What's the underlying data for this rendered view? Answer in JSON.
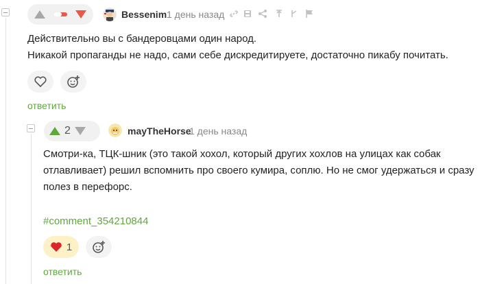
{
  "comment1": {
    "author": "Bessenim",
    "time": "1 день назад",
    "text_line1": "Действительно вы с бандеровцами один народ.",
    "text_line2": "Никакой пропаганды не надо, сами себе дискредитируете, достаточно пикабу почитать.",
    "reply_label": "ответить",
    "vote": {
      "down_active": true,
      "rating_bar_fraction": 0.45
    },
    "tool_icons": [
      "link-icon",
      "save-icon",
      "share-icon",
      "pin-icon",
      "branch-icon",
      "flag-icon"
    ]
  },
  "comment2": {
    "author": "mayTheHorse",
    "time": "1 день назад",
    "rating": "2",
    "text_line1": "Смотри-ка, ТЦК-шник (это такой хохол, который других хохлов на улицах как собак",
    "text_line2": "отлавливает) решил вспомнить про своего кумира, соплю. Но не смог удержаться и сразу",
    "text_line3": "полез в перефорс.",
    "hashtag": "#comment_354210844",
    "heart_count": "1",
    "reply_label": "ответить"
  },
  "colors": {
    "accent_green": "#5ea83c",
    "down_red": "#e8594b",
    "heart_red": "#d9262a",
    "reaction_yellow": "#fdf1c8"
  }
}
